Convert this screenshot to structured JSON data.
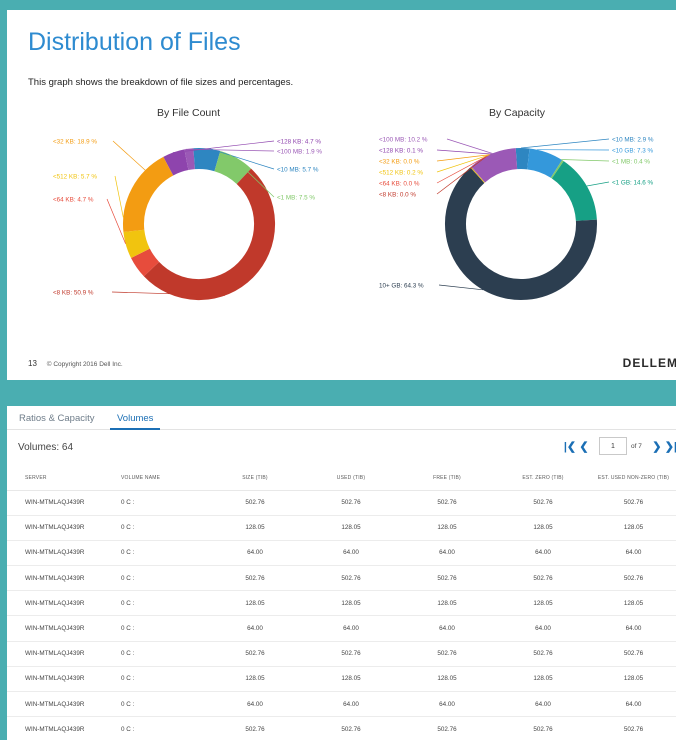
{
  "slide": {
    "title": "Distribution of Files",
    "subtitle": "This graph shows the breakdown of file sizes and percentages.",
    "page_number": "13",
    "copyright": "© Copyright 2016 Dell Inc.",
    "logo": "DELLEM"
  },
  "chart_data": [
    {
      "type": "pie",
      "donut": true,
      "title": "By File Count",
      "slices": [
        {
          "label": "<128 KB: 4.7 %",
          "value": 4.7,
          "color": "#8e44ad"
        },
        {
          "label": "<100 MB: 1.9 %",
          "value": 1.9,
          "color": "#9b59b6"
        },
        {
          "label": "<10 MB: 5.7 %",
          "value": 5.7,
          "color": "#2e86c1"
        },
        {
          "label": "<1 MB: 7.5 %",
          "value": 7.5,
          "color": "#82c96a"
        },
        {
          "label": "<8 KB: 50.9 %",
          "value": 50.9,
          "color": "#c0392b"
        },
        {
          "label": "<64 KB: 4.7 %",
          "value": 4.7,
          "color": "#e74c3c"
        },
        {
          "label": "<512 KB: 5.7 %",
          "value": 5.7,
          "color": "#f1c40f"
        },
        {
          "label": "<32 KB: 18.9 %",
          "value": 18.9,
          "color": "#f39c12"
        }
      ]
    },
    {
      "type": "pie",
      "donut": true,
      "title": "By Capacity",
      "slices": [
        {
          "label": "<10 MB: 2.9 %",
          "value": 2.9,
          "color": "#2e86c1"
        },
        {
          "label": "<10 GB: 7.3 %",
          "value": 7.3,
          "color": "#3498db"
        },
        {
          "label": "<1 MB: 0.4 %",
          "value": 0.4,
          "color": "#82c96a"
        },
        {
          "label": "<1 GB: 14.6 %",
          "value": 14.6,
          "color": "#16a085"
        },
        {
          "label": "10+ GB: 64.3 %",
          "value": 64.3,
          "color": "#2c3e50"
        },
        {
          "label": "<8 KB: 0.0 %",
          "value": 0.0,
          "color": "#c0392b"
        },
        {
          "label": "<64 KB: 0.0 %",
          "value": 0.0,
          "color": "#e74c3c"
        },
        {
          "label": "<512 KB: 0.2 %",
          "value": 0.2,
          "color": "#f1c40f"
        },
        {
          "label": "<32 KB: 0.0 %",
          "value": 0.0,
          "color": "#f39c12"
        },
        {
          "label": "<128 KB: 0.1 %",
          "value": 0.1,
          "color": "#8e44ad"
        },
        {
          "label": "<100 MB: 10.2 %",
          "value": 10.2,
          "color": "#9b59b6"
        }
      ]
    }
  ],
  "panel": {
    "tabs": [
      {
        "label": "Ratios & Capacity",
        "active": false
      },
      {
        "label": "Volumes",
        "active": true
      }
    ],
    "volumes_label": "Volumes: 64",
    "pager": {
      "current": "1",
      "of_label": "of 7"
    },
    "columns": [
      "SERVER",
      "VOLUME NAME",
      "SIZE (TIB)",
      "USED (TIB)",
      "FREE (TIB)",
      "EST. ZERO (TIB)",
      "EST. USED NON-ZERO (TIB)"
    ],
    "rows": [
      [
        "WIN-MTMLAQJ439R",
        "0 C :",
        "502.76",
        "502.76",
        "502.76",
        "502.76",
        "502.76"
      ],
      [
        "WIN-MTMLAQJ439R",
        "0 C :",
        "128.05",
        "128.05",
        "128.05",
        "128.05",
        "128.05"
      ],
      [
        "WIN-MTMLAQJ439R",
        "0 C :",
        "64.00",
        "64.00",
        "64.00",
        "64.00",
        "64.00"
      ],
      [
        "WIN-MTMLAQJ439R",
        "0 C :",
        "502.76",
        "502.76",
        "502.76",
        "502.76",
        "502.76"
      ],
      [
        "WIN-MTMLAQJ439R",
        "0 C :",
        "128.05",
        "128.05",
        "128.05",
        "128.05",
        "128.05"
      ],
      [
        "WIN-MTMLAQJ439R",
        "0 C :",
        "64.00",
        "64.00",
        "64.00",
        "64.00",
        "64.00"
      ],
      [
        "WIN-MTMLAQJ439R",
        "0 C :",
        "502.76",
        "502.76",
        "502.76",
        "502.76",
        "502.76"
      ],
      [
        "WIN-MTMLAQJ439R",
        "0 C :",
        "128.05",
        "128.05",
        "128.05",
        "128.05",
        "128.05"
      ],
      [
        "WIN-MTMLAQJ439R",
        "0 C :",
        "64.00",
        "64.00",
        "64.00",
        "64.00",
        "64.00"
      ],
      [
        "WIN-MTMLAQJ439R",
        "0 C :",
        "502.76",
        "502.76",
        "502.76",
        "502.76",
        "502.76"
      ]
    ]
  }
}
